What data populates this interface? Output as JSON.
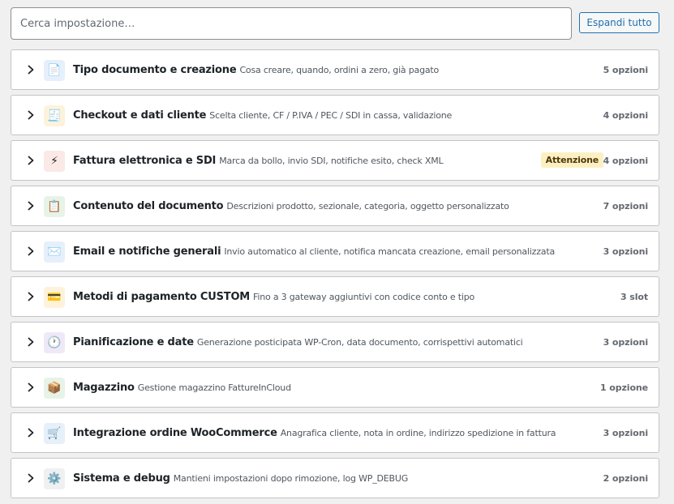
{
  "search": {
    "placeholder": "Cerca impostazione…",
    "value": ""
  },
  "expand_label": "Espandi tutto",
  "sections": [
    {
      "title": "Tipo documento e creazione",
      "desc": "Cosa creare, quando, ordini a zero, già pagato",
      "count": "5 opzioni",
      "icon": "document-icon",
      "glyph": "📄",
      "bg": "#e6f0fb",
      "name": "tipo-documento"
    },
    {
      "title": "Checkout e dati cliente",
      "desc": "Scelta cliente, CF / P.IVA / PEC / SDI in cassa, validazione",
      "count": "4 opzioni",
      "icon": "receipt-icon",
      "glyph": "🧾",
      "bg": "#fdf3dc",
      "name": "checkout"
    },
    {
      "title": "Fattura elettronica e SDI",
      "desc": "Marca da bollo, invio SDI, notifiche esito, check XML",
      "count": "4 opzioni",
      "badge": "Attenzione",
      "icon": "lightning-icon",
      "glyph": "⚡",
      "bg": "#fbe9e7",
      "name": "fattura-elettronica"
    },
    {
      "title": "Contenuto del documento",
      "desc": "Descrizioni prodotto, sezionale, categoria, oggetto personalizzato",
      "count": "7 opzioni",
      "icon": "clipboard-icon",
      "glyph": "📋",
      "bg": "#e8f3e8",
      "name": "contenuto"
    },
    {
      "title": "Email e notifiche generali",
      "desc": "Invio automatico al cliente, notifica mancata creazione, email personalizzata",
      "count": "3 opzioni",
      "icon": "envelope-icon",
      "glyph": "✉️",
      "bg": "#e6f0fb",
      "name": "email"
    },
    {
      "title": "Metodi di pagamento CUSTOM",
      "desc": "Fino a 3 gateway aggiuntivi con codice conto e tipo",
      "count": "3 slot",
      "icon": "credit-card-icon",
      "glyph": "💳",
      "bg": "#fdf3dc",
      "name": "pagamento"
    },
    {
      "title": "Pianificazione e date",
      "desc": "Generazione posticipata WP-Cron, data documento, corrispettivi automatici",
      "count": "3 opzioni",
      "icon": "clock-icon",
      "glyph": "🕐",
      "bg": "#efe8f7",
      "name": "pianificazione"
    },
    {
      "title": "Magazzino",
      "desc": "Gestione magazzino FattureInCloud",
      "count": "1 opzione",
      "icon": "package-icon",
      "glyph": "📦",
      "bg": "#e8f3e8",
      "name": "magazzino"
    },
    {
      "title": "Integrazione ordine WooCommerce",
      "desc": "Anagrafica cliente, nota in ordine, indirizzo spedizione in fattura",
      "count": "3 opzioni",
      "icon": "cart-icon",
      "glyph": "🛒",
      "bg": "#e6f0fb",
      "name": "integrazione"
    },
    {
      "title": "Sistema e debug",
      "desc": "Mantieni impostazioni dopo rimozione, log WP_DEBUG",
      "count": "2 opzioni",
      "icon": "gear-icon",
      "glyph": "⚙️",
      "bg": "#eef0f2",
      "name": "sistema"
    }
  ]
}
